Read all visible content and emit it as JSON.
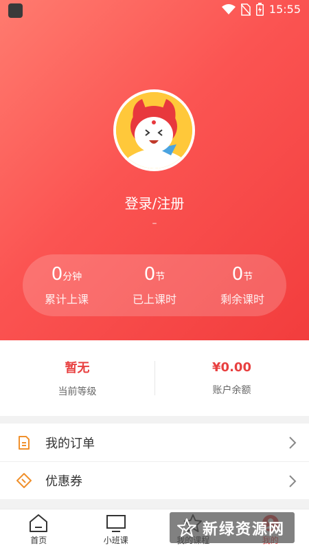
{
  "status_bar": {
    "time": "15:55"
  },
  "profile": {
    "login_label": "登录/注册",
    "sub_label": "–"
  },
  "stats": [
    {
      "value": "0",
      "unit": "分钟",
      "label": "累计上课"
    },
    {
      "value": "0",
      "unit": "节",
      "label": "已上课时"
    },
    {
      "value": "0",
      "unit": "节",
      "label": "剩余课时"
    }
  ],
  "account": {
    "level_value": "暂无",
    "level_label": "当前等级",
    "balance_value": "¥0.00",
    "balance_label": "账户余额"
  },
  "menu": [
    {
      "label": "我的订单",
      "icon": "order-icon"
    },
    {
      "label": "优惠券",
      "icon": "coupon-icon"
    }
  ],
  "tabs": [
    {
      "label": "首页",
      "icon": "home-icon"
    },
    {
      "label": "小班课",
      "icon": "monitor-icon"
    },
    {
      "label": "我的课程",
      "icon": "star-icon"
    },
    {
      "label": "我的",
      "icon": "profile-icon",
      "active": true
    }
  ],
  "watermark": {
    "text": "新绿资源网"
  },
  "colors": {
    "accent": "#e84040",
    "hero_start": "#ff7b6f",
    "hero_end": "#f23d3d"
  }
}
